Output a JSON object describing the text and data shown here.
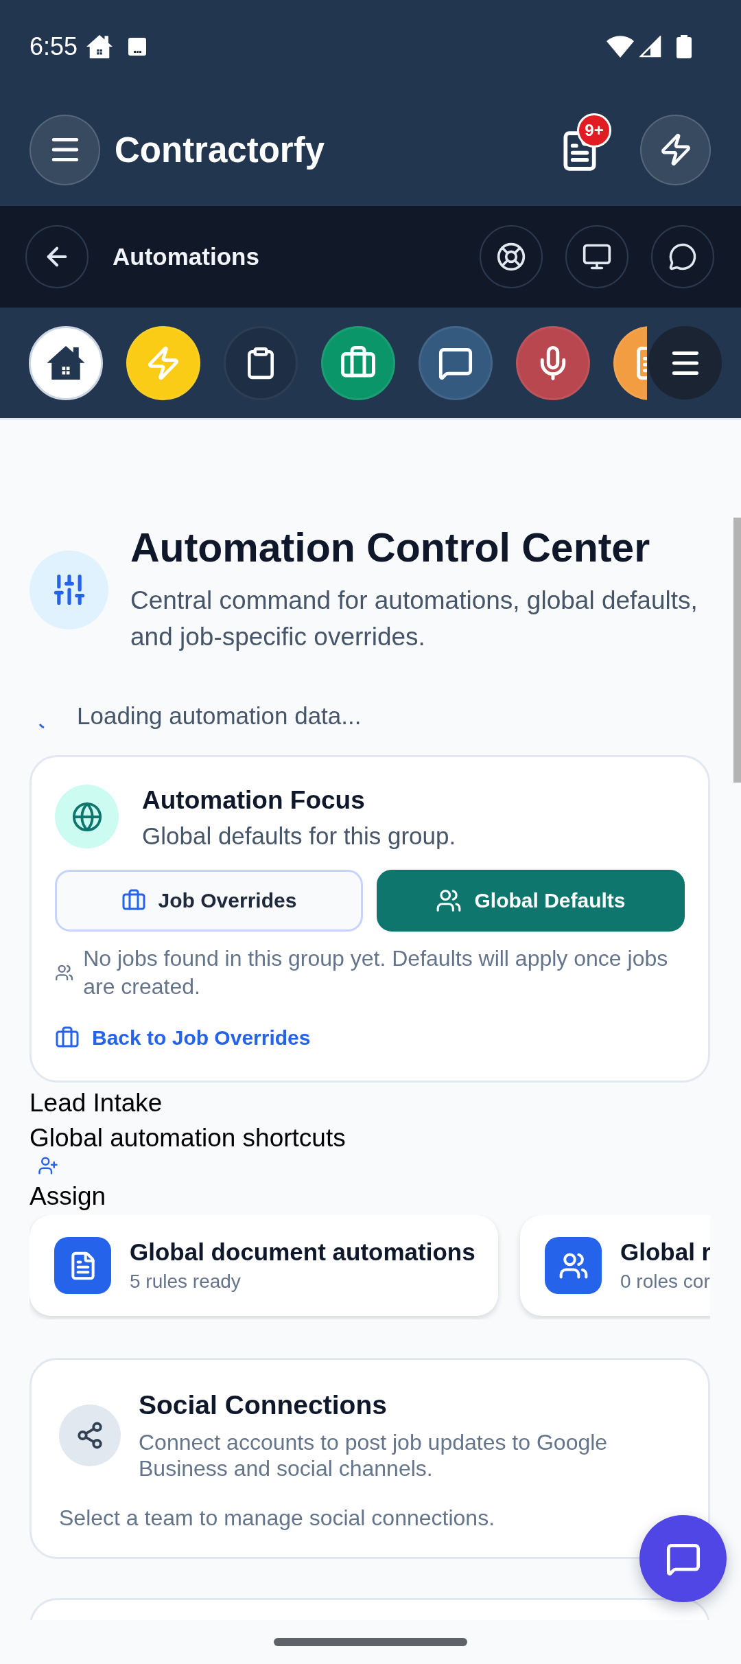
{
  "status_bar": {
    "time": "6:55"
  },
  "app_bar": {
    "title": "Contractorfy",
    "notification_badge": "9+"
  },
  "page_bar": {
    "title": "Automations"
  },
  "quick_nav": [
    {
      "kind": "home",
      "color": "#ffffff"
    },
    {
      "kind": "bolt",
      "color": "#facc15"
    },
    {
      "kind": "clipboard",
      "color": "#1e2f45"
    },
    {
      "kind": "briefcase",
      "color": "#0b9669"
    },
    {
      "kind": "chat",
      "color": "#345a7f"
    },
    {
      "kind": "mic",
      "color": "#b9474f"
    },
    {
      "kind": "document",
      "color": "#f29d41"
    }
  ],
  "header": {
    "title": "Automation Control Center",
    "description": "Central command for automations, global defaults, and job-specific overrides."
  },
  "loading": {
    "text": "Loading automation data..."
  },
  "focus_card": {
    "title": "Automation Focus",
    "subtitle": "Global defaults for this group.",
    "view_toggle": [
      {
        "kind": "briefcase",
        "label": "Job Overrides",
        "selected": false
      },
      {
        "kind": "users",
        "label": "Global Defaults",
        "selected": true
      }
    ],
    "notice": "No jobs found in this group yet. Defaults will apply once jobs are created.",
    "link": "Back to Job Overrides"
  },
  "lead_intake": {
    "title": "Lead Intake",
    "subtitle": "Global automation shortcuts",
    "action": "Assign"
  },
  "shortcuts": [
    {
      "kind": "document",
      "title": "Global document automations",
      "detail": "5 rules ready"
    },
    {
      "kind": "users",
      "title": "Global r",
      "detail": "0 roles cor"
    }
  ],
  "social_card": {
    "title": "Social Connections",
    "description": "Connect accounts to post job updates to Google Business and social channels.",
    "note": "Select a team to manage social connections."
  }
}
